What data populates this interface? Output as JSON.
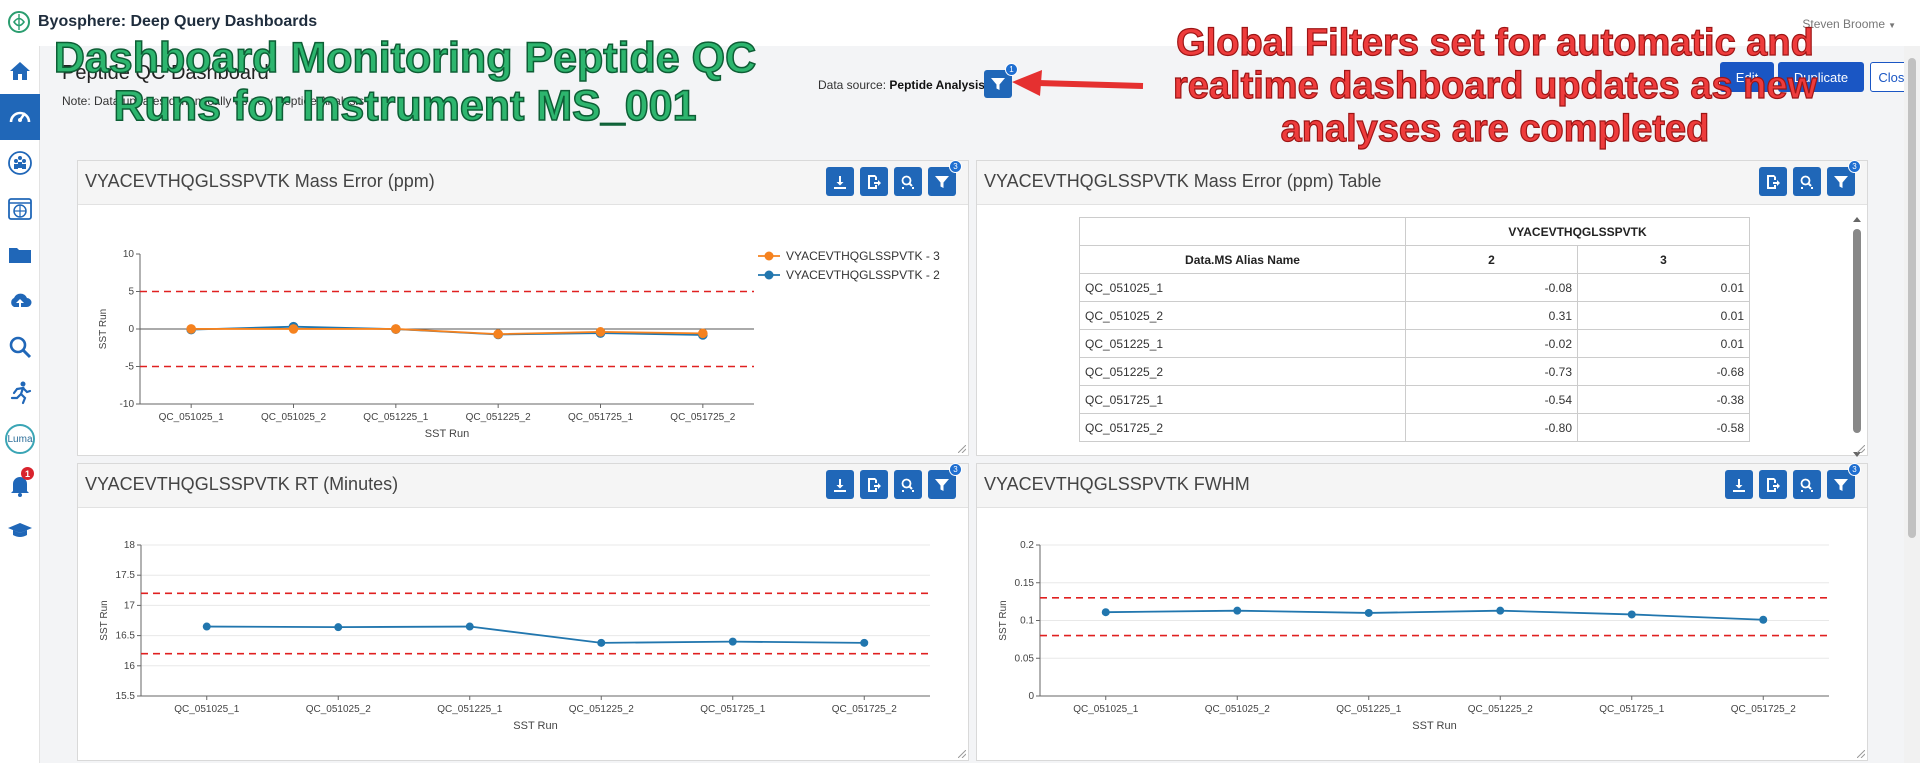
{
  "app": {
    "title": "Byosphere: Deep Query Dashboards",
    "user": "Steven Broome"
  },
  "sidebar": {
    "items": [
      {
        "icon": "home-icon"
      },
      {
        "icon": "dashboard-gauge-icon",
        "active": true
      },
      {
        "icon": "people-network-icon"
      },
      {
        "icon": "world-browser-icon"
      },
      {
        "icon": "folder-icon"
      },
      {
        "icon": "cloud-upload-icon"
      },
      {
        "icon": "search-icon"
      },
      {
        "icon": "runner-icon"
      },
      {
        "icon": "luma-icon",
        "label": "Luma"
      },
      {
        "icon": "bell-icon",
        "badge": "1"
      },
      {
        "icon": "graduation-cap-icon"
      }
    ]
  },
  "header": {
    "title": "Peptide QC Dashboard",
    "note": "Note: Data updates dynamically as new Peptide Analysis",
    "datasource_label": "Data source:",
    "datasource_value": "Peptide Analysis",
    "filter_badge": "1",
    "edit_label": "Edit",
    "duplicate_label": "Duplicate",
    "close_label": "Close"
  },
  "annotations": {
    "left": "Dashboard Monitoring Peptide QC Runs for Instrument MS_001",
    "right": "Global Filters set for automatic and realtime dashboard updates as new analyses are completed"
  },
  "colors": {
    "primary": "#2067b8",
    "series_orange": "#f5821f",
    "series_blue": "#2176ae",
    "limit_red": "#e02020"
  },
  "panels": {
    "mass_error": {
      "title": "VYACEVTHQGLSSPVTK Mass Error (ppm)",
      "filter_badge": "3",
      "chart_data": {
        "type": "line",
        "categories": [
          "QC_051025_1",
          "QC_051025_2",
          "QC_051225_1",
          "QC_051225_2",
          "QC_051725_1",
          "QC_051725_2"
        ],
        "series": [
          {
            "name": "VYACEVTHQGLSSPVTK - 3",
            "values": [
              0.01,
              0.01,
              0.01,
              -0.68,
              -0.38,
              -0.58
            ],
            "color": "#f5821f"
          },
          {
            "name": "VYACEVTHQGLSSPVTK - 2",
            "values": [
              -0.08,
              0.31,
              -0.02,
              -0.73,
              -0.54,
              -0.8
            ],
            "color": "#2176ae"
          }
        ],
        "reference_lines": [
          5,
          -5
        ],
        "ylim": [
          -10,
          10
        ],
        "yticks": [
          "10",
          "5",
          "0",
          "-5",
          "-10"
        ],
        "xlabel": "SST Run",
        "ylabel": "SST Run",
        "legend": "top-right"
      }
    },
    "mass_error_table": {
      "title": "VYACEVTHQGLSSPVTK Mass Error (ppm) Table",
      "group_header": "VYACEVTHQGLSSPVTK",
      "row_header": "Data.MS Alias Name",
      "col_2": "2",
      "col_3": "3",
      "rows": [
        {
          "name": "QC_051025_1",
          "v2": "-0.08",
          "v3": "0.01"
        },
        {
          "name": "QC_051025_2",
          "v2": "0.31",
          "v3": "0.01"
        },
        {
          "name": "QC_051225_1",
          "v2": "-0.02",
          "v3": "0.01"
        },
        {
          "name": "QC_051225_2",
          "v2": "-0.73",
          "v3": "-0.68"
        },
        {
          "name": "QC_051725_1",
          "v2": "-0.54",
          "v3": "-0.38"
        },
        {
          "name": "QC_051725_2",
          "v2": "-0.80",
          "v3": "-0.58"
        }
      ]
    },
    "rt": {
      "title": "VYACEVTHQGLSSPVTK RT (Minutes)",
      "filter_badge": "3",
      "chart_data": {
        "type": "line",
        "categories": [
          "QC_051025_1",
          "QC_051025_2",
          "QC_051225_1",
          "QC_051225_2",
          "QC_051725_1",
          "QC_051725_2"
        ],
        "series": [
          {
            "values": [
              16.65,
              16.64,
              16.65,
              16.38,
              16.4,
              16.38
            ],
            "color": "#2176ae"
          }
        ],
        "reference_lines": [
          17.2,
          16.2
        ],
        "ylim": [
          15.5,
          18
        ],
        "yticks": [
          "18",
          "17.5",
          "17",
          "16.5",
          "16",
          "15.5"
        ],
        "xlabel": "SST Run",
        "ylabel": "SST Run"
      }
    },
    "fwhm": {
      "title": "VYACEVTHQGLSSPVTK FWHM",
      "filter_badge": "3",
      "chart_data": {
        "type": "line",
        "categories": [
          "QC_051025_1",
          "QC_051025_2",
          "QC_051225_1",
          "QC_051225_2",
          "QC_051725_1",
          "QC_051725_2"
        ],
        "series": [
          {
            "values": [
              0.111,
              0.113,
              0.11,
              0.113,
              0.108,
              0.101
            ],
            "color": "#2176ae"
          }
        ],
        "reference_lines": [
          0.13,
          0.08
        ],
        "ylim": [
          0,
          0.2
        ],
        "yticks": [
          "0.2",
          "0.15",
          "0.1",
          "0.05",
          "0"
        ],
        "xlabel": "SST Run",
        "ylabel": "SST Run"
      }
    }
  }
}
